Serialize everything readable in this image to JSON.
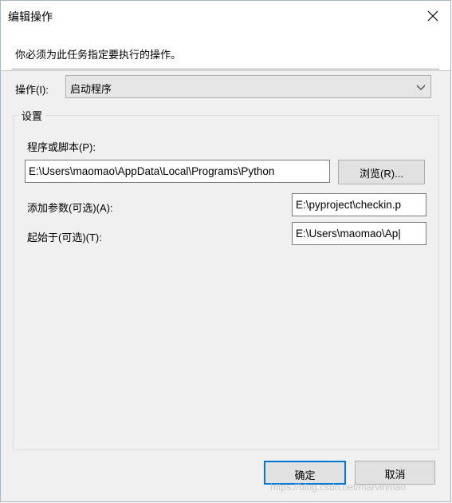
{
  "window": {
    "title": "编辑操作"
  },
  "description": "你必须为此任务指定要执行的操作。",
  "action": {
    "label": "操作(I):",
    "selected": "启动程序"
  },
  "settings": {
    "title": "设置",
    "program_label": "程序或脚本(P):",
    "program_value": "E:\\Users\\maomao\\AppData\\Local\\Programs\\Python",
    "browse_label": "浏览(R)...",
    "args_label": "添加参数(可选)(A):",
    "args_value": "E:\\pyproject\\checkin.p",
    "startin_label": "起始于(可选)(T):",
    "startin_value": "E:\\Users\\maomao\\Ap|"
  },
  "buttons": {
    "ok": "确定",
    "cancel": "取消"
  },
  "watermark": "https://blog.csdn.net/marvinmao",
  "icons": {
    "close": "close-icon",
    "dropdown": "chevron-down-icon"
  },
  "colors": {
    "accent": "#0078d7"
  }
}
